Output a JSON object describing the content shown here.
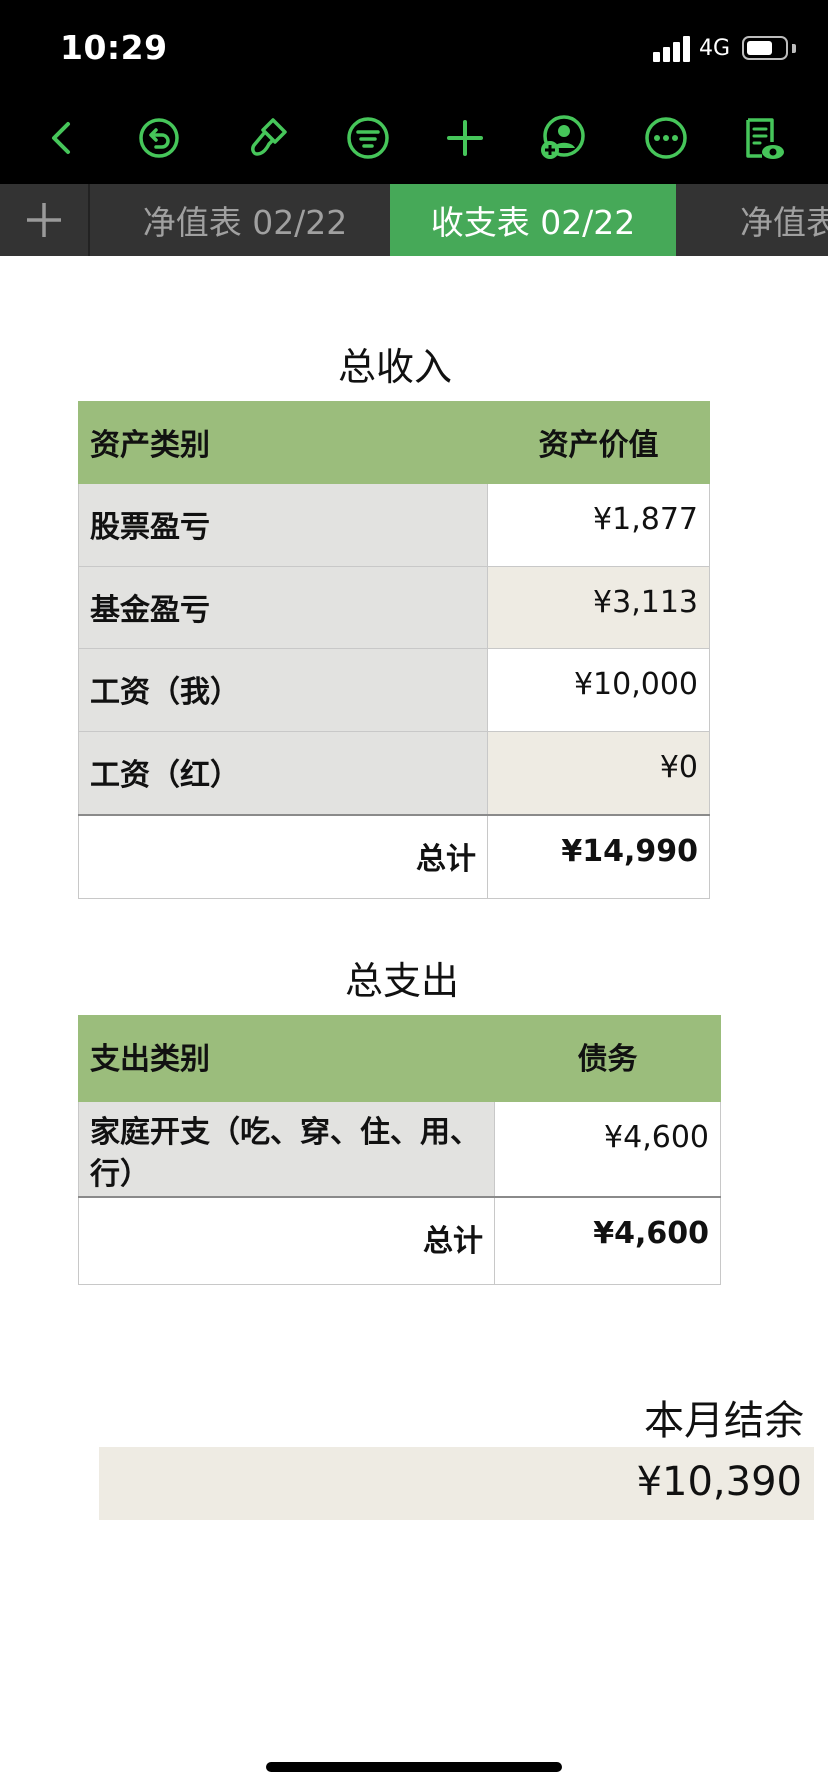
{
  "status_bar": {
    "time": "10:29",
    "network": "4G",
    "battery_level": 0.7
  },
  "toolbar": {
    "icons": [
      "back-chevron-icon",
      "undo-icon",
      "paintbrush-icon",
      "filter-icon",
      "plus-icon",
      "collaborate-icon",
      "more-icon",
      "reading-mode-icon"
    ],
    "accent_color": "#46c65a"
  },
  "tabs": {
    "items": [
      {
        "label": "净值表 02/22",
        "active": false
      },
      {
        "label": "收支表 02/22",
        "active": true
      },
      {
        "label": "净值表",
        "active": false
      }
    ]
  },
  "income": {
    "title": "总收入",
    "headers": [
      "资产类别",
      "资产价值"
    ],
    "rows": [
      {
        "category": "股票盈亏",
        "value": "¥1,877"
      },
      {
        "category": "基金盈亏",
        "value": "¥3,113"
      },
      {
        "category": "工资（我）",
        "value": "¥10,000"
      },
      {
        "category": "工资（红）",
        "value": "¥0"
      }
    ],
    "total_label": "总计",
    "total_value": "¥14,990"
  },
  "expense": {
    "title": "总支出",
    "headers": [
      "支出类别",
      "债务"
    ],
    "rows": [
      {
        "category": "家庭开支（吃、穿、住、用、行）",
        "value": "¥4,600"
      }
    ],
    "total_label": "总计",
    "total_value": "¥4,600"
  },
  "balance": {
    "label": "本月结余",
    "value": "¥10,390"
  },
  "colors": {
    "header_green": "#9bbd7c",
    "tab_active": "#46a958",
    "category_gray": "#e2e2e0",
    "value_beige": "#eeebe3"
  }
}
